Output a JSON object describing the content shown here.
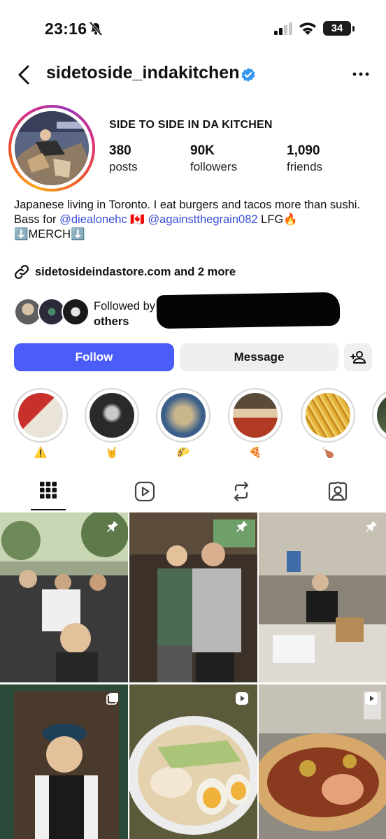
{
  "status_bar": {
    "time": "23:16",
    "battery": "34"
  },
  "header": {
    "username": "sidetoside_indakitchen"
  },
  "profile": {
    "display_name": "SIDE TO SIDE IN DA KITCHEN",
    "stats": [
      {
        "value": "380",
        "label": "posts"
      },
      {
        "value": "90K",
        "label": "followers"
      },
      {
        "value": "1,090",
        "label": "friends"
      }
    ]
  },
  "bio": {
    "line1": "Japanese living in Toronto. I eat burgers and tacos more than sushi.",
    "bass_for": "Bass for",
    "mention1": "@diealonehc",
    "flag": "🇨🇦",
    "mention2": "@againstthegrain082",
    "lfg": "LFG🔥",
    "merch": "⬇️MERCH⬇️",
    "link": "sidetosideindastore.com and 2 more"
  },
  "followed_by": {
    "prefix": "Followed by",
    "others": "others"
  },
  "actions": {
    "follow": "Follow",
    "message": "Message"
  },
  "highlights": [
    {
      "emoji": "⚠️"
    },
    {
      "emoji": "🤘"
    },
    {
      "emoji": "🌮"
    },
    {
      "emoji": "🍕"
    },
    {
      "emoji": "🍗"
    }
  ],
  "tabs": [
    "grid-icon",
    "reels-icon",
    "repost-icon",
    "tagged-icon"
  ],
  "posts": [
    {
      "kind": "pinned"
    },
    {
      "kind": "pinned"
    },
    {
      "kind": "pinned"
    },
    {
      "kind": "carousel"
    },
    {
      "kind": "reel"
    },
    {
      "kind": "reel"
    }
  ],
  "colors": {
    "follow_button": "#4a5df9",
    "mention": "#3b4fd8",
    "secondary_button": "#efefef"
  }
}
